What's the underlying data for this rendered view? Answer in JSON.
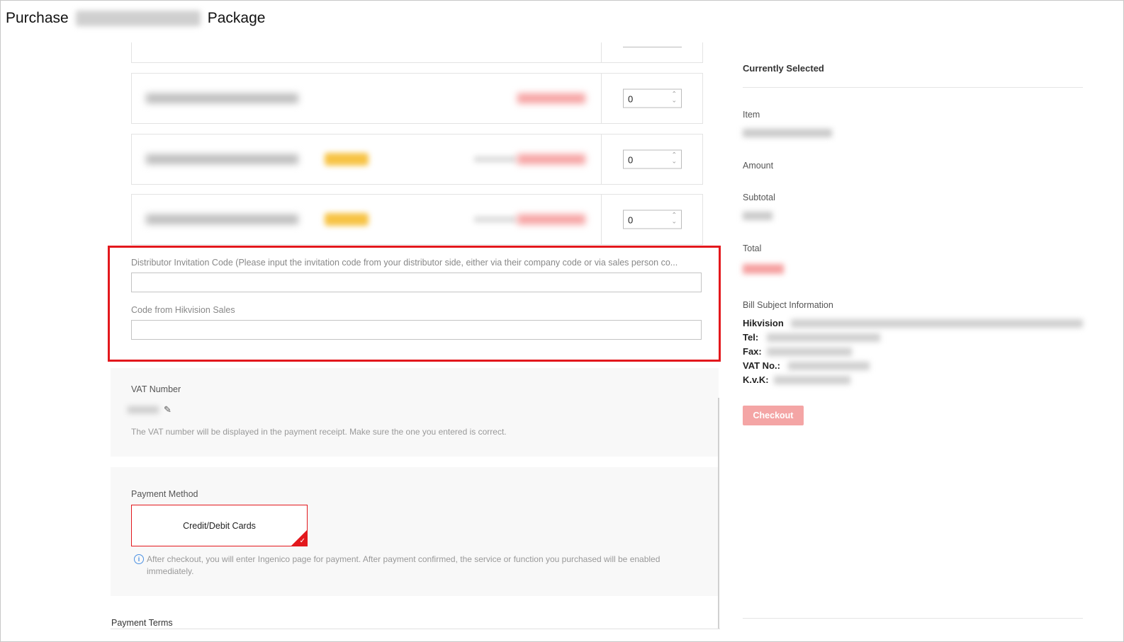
{
  "page": {
    "title_prefix": "Purchase",
    "title_suffix": "Package"
  },
  "products": [
    {
      "quantity": "0"
    },
    {
      "quantity": "0"
    },
    {
      "quantity": "0"
    }
  ],
  "codes": {
    "distributor_label": "Distributor Invitation Code (Please input the invitation code from your distributor side, either via their company code or via sales person co...",
    "distributor_value": "",
    "sales_label": "Code from Hikvision Sales",
    "sales_value": ""
  },
  "vat": {
    "label": "VAT Number",
    "hint": "The VAT number will be displayed in the payment receipt. Make sure the one you entered is correct.",
    "edit_icon": "pencil-icon"
  },
  "payment": {
    "label": "Payment Method",
    "option": "Credit/Debit Cards",
    "info": "After checkout, you will enter Ingenico page for payment. After payment confirmed, the service or function you purchased will be enabled immediately.",
    "info_icon": "info-icon",
    "selected_icon": "check-icon"
  },
  "terms": {
    "label": "Payment Terms"
  },
  "summary": {
    "title": "Currently Selected",
    "item_label": "Item",
    "amount_label": "Amount",
    "subtotal_label": "Subtotal",
    "total_label": "Total",
    "bill_label": "Bill Subject Information",
    "company": "Hikvision",
    "tel_label": "Tel:",
    "fax_label": "Fax:",
    "vat_label": "VAT No.:",
    "kvk_label": "K.v.K:",
    "checkout_label": "Checkout"
  },
  "colors": {
    "accent": "#e3181d",
    "checkout_disabled": "#f4a5a5",
    "badge": "#f7c344"
  }
}
